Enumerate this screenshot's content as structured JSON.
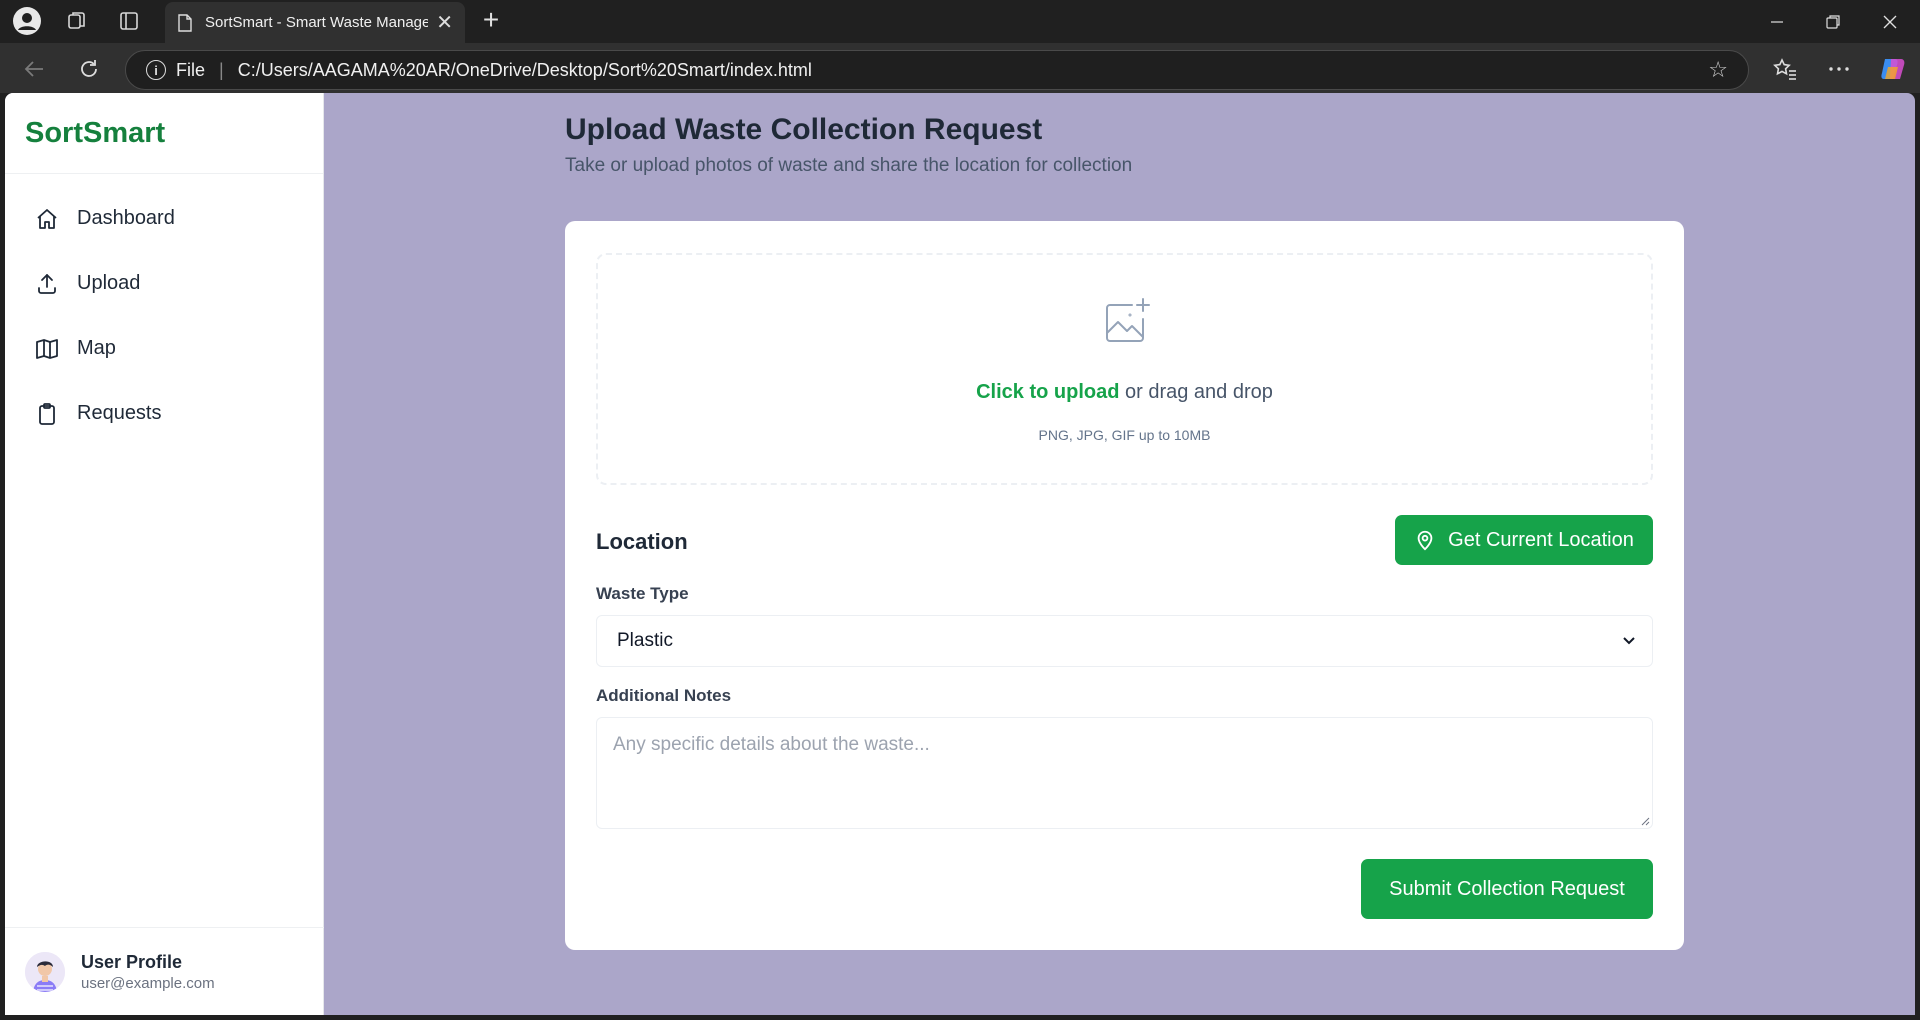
{
  "browser": {
    "tab_title": "SortSmart - Smart Waste Manage",
    "address_prefix": "File",
    "url": "C:/Users/AAGAMA%20AR/OneDrive/Desktop/Sort%20Smart/index.html"
  },
  "sidebar": {
    "brand": "SortSmart",
    "items": [
      {
        "label": "Dashboard",
        "icon": "home-icon"
      },
      {
        "label": "Upload",
        "icon": "upload-icon"
      },
      {
        "label": "Map",
        "icon": "map-icon"
      },
      {
        "label": "Requests",
        "icon": "clipboard-icon"
      }
    ],
    "profile": {
      "name": "User Profile",
      "email": "user@example.com"
    }
  },
  "main": {
    "title": "Upload Waste Collection Request",
    "subtitle": "Take or upload photos of waste and share the location for collection",
    "upload": {
      "link": "Click to upload",
      "rest": " or drag and drop",
      "hint": "PNG, JPG, GIF up to 10MB"
    },
    "location": {
      "label": "Location",
      "button": "Get Current Location"
    },
    "waste_type": {
      "label": "Waste Type",
      "value": "Plastic"
    },
    "notes": {
      "label": "Additional Notes",
      "placeholder": "Any specific details about the waste..."
    },
    "submit": "Submit Collection Request"
  },
  "colors": {
    "brand": "#15803d",
    "accent": "#16a34a",
    "page_background": "#aba6c9"
  }
}
